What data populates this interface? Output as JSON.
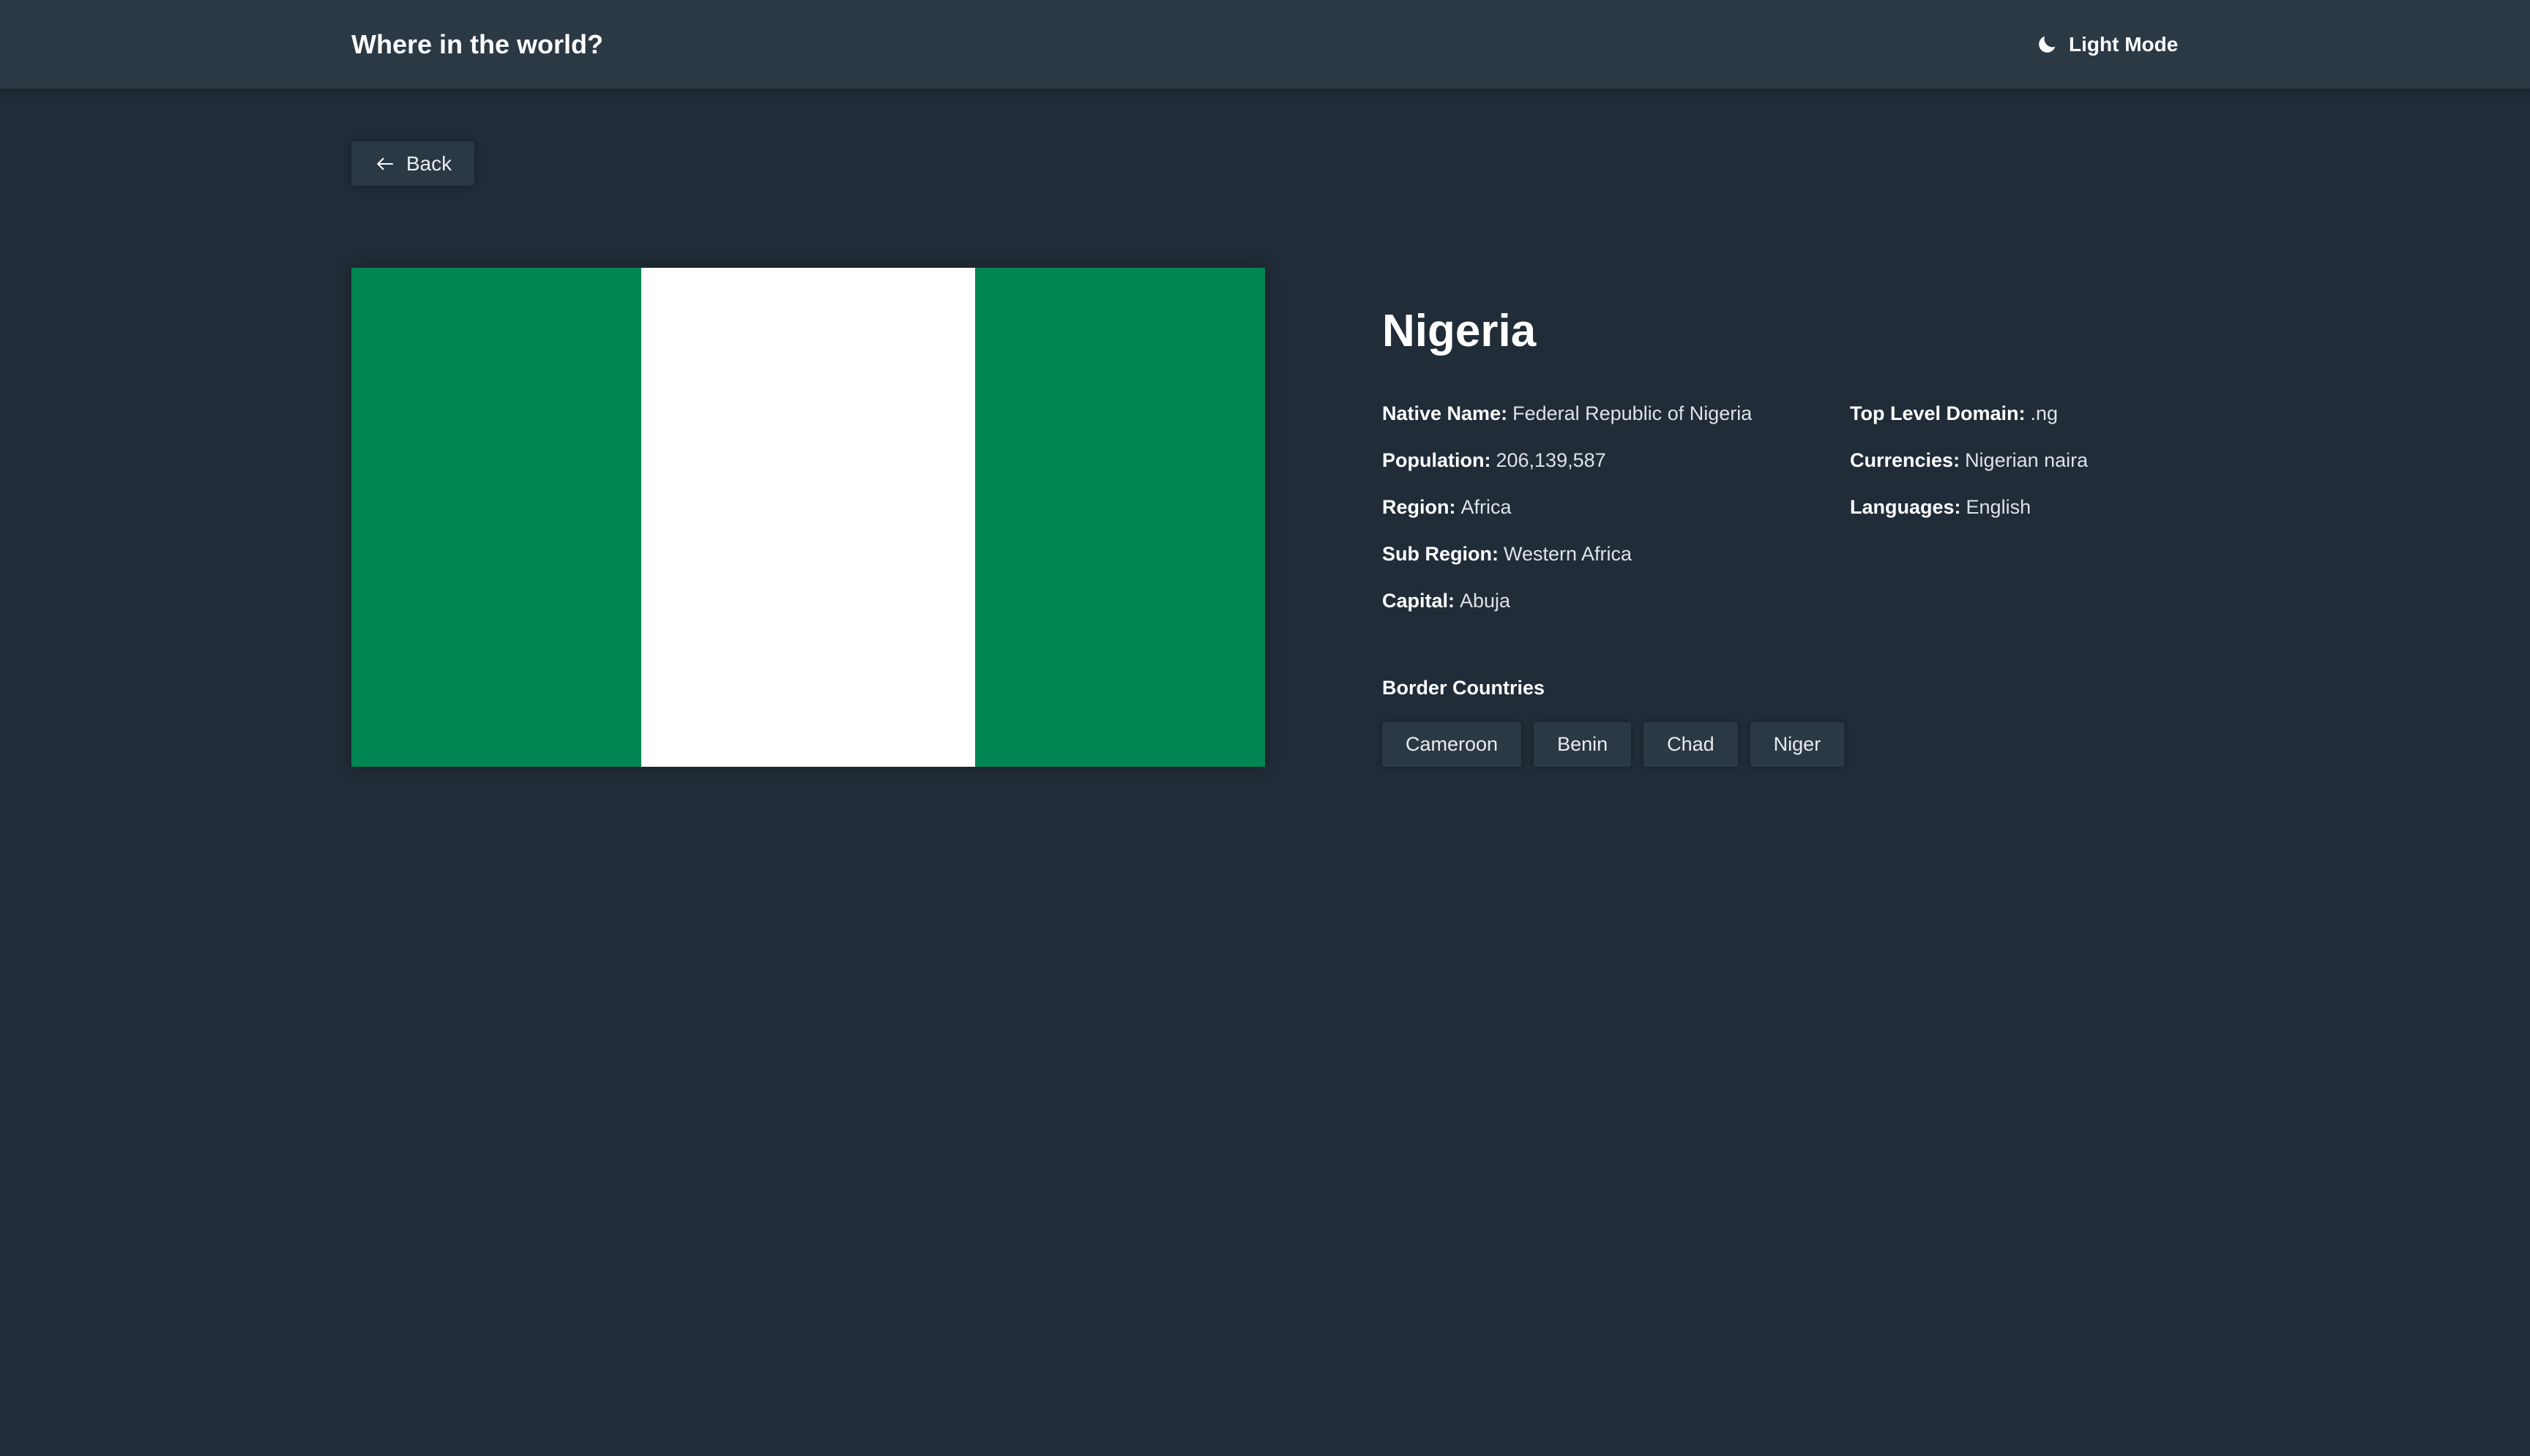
{
  "header": {
    "title": "Where in the world?",
    "mode_label": "Light Mode",
    "mode_icon": "moon-icon"
  },
  "back": {
    "label": "Back",
    "icon": "arrow-left-icon"
  },
  "country": {
    "name": "Nigeria",
    "flag": {
      "colors": [
        "#008751",
        "#ffffff",
        "#008751"
      ]
    },
    "details_left": [
      {
        "key": "Native Name:",
        "value": "Federal Republic of Nigeria"
      },
      {
        "key": "Population:",
        "value": "206,139,587"
      },
      {
        "key": "Region:",
        "value": "Africa"
      },
      {
        "key": "Sub Region:",
        "value": "Western Africa"
      },
      {
        "key": "Capital:",
        "value": "Abuja"
      }
    ],
    "details_right": [
      {
        "key": "Top Level Domain:",
        "value": ".ng"
      },
      {
        "key": "Currencies:",
        "value": "Nigerian naira"
      },
      {
        "key": "Languages:",
        "value": "English"
      }
    ],
    "border_heading": "Border Countries",
    "borders": [
      "Cameroon",
      "Benin",
      "Chad",
      "Niger"
    ]
  },
  "theme": {
    "background": "#202c37",
    "element": "#2b3945",
    "text": "#ffffff"
  }
}
